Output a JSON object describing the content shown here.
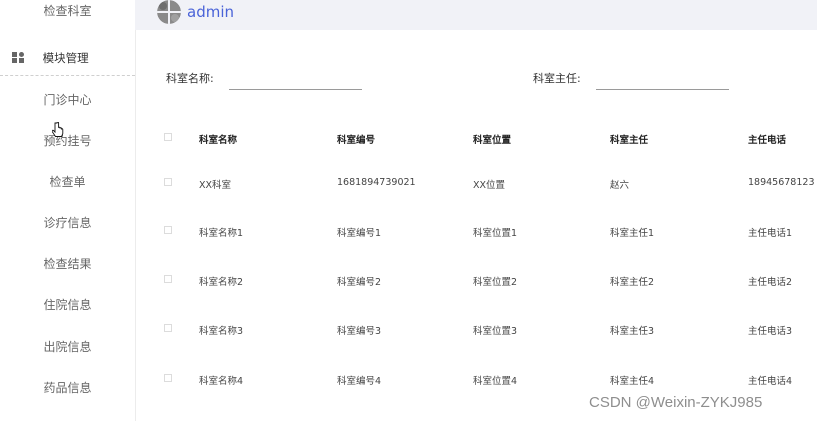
{
  "sidebar": {
    "items": [
      {
        "label": "检查科室"
      },
      {
        "label": "模块管理"
      },
      {
        "label": "门诊中心"
      },
      {
        "label": "预约挂号"
      },
      {
        "label": "检查单"
      },
      {
        "label": "诊疗信息"
      },
      {
        "label": "检查结果"
      },
      {
        "label": "住院信息"
      },
      {
        "label": "出院信息"
      },
      {
        "label": "药品信息"
      }
    ]
  },
  "header": {
    "username": "admin"
  },
  "filters": {
    "dept_name_label": "科室名称:",
    "dept_head_label": "科室主任:",
    "dept_name_value": "",
    "dept_head_value": ""
  },
  "table": {
    "columns": [
      "科室名称",
      "科室编号",
      "科室位置",
      "科室主任",
      "主任电话"
    ],
    "rows": [
      [
        "XX科室",
        "1681894739021",
        "XX位置",
        "赵六",
        "18945678123"
      ],
      [
        "科室名称1",
        "科室编号1",
        "科室位置1",
        "科室主任1",
        "主任电话1"
      ],
      [
        "科室名称2",
        "科室编号2",
        "科室位置2",
        "科室主任2",
        "主任电话2"
      ],
      [
        "科室名称3",
        "科室编号3",
        "科室位置3",
        "科室主任3",
        "主任电话3"
      ],
      [
        "科室名称4",
        "科室编号4",
        "科室位置4",
        "科室主任4",
        "主任电话4"
      ]
    ]
  },
  "watermark": "CSDN @Weixin-ZYKJ985"
}
